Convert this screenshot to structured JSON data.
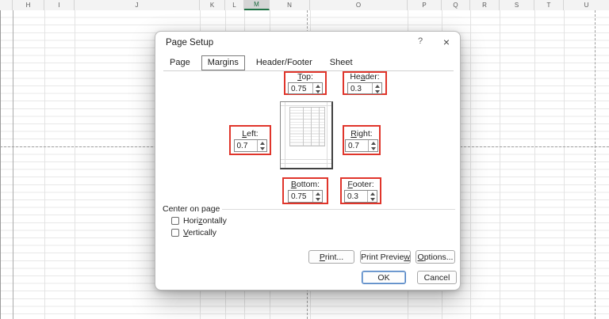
{
  "spreadsheet": {
    "columns": [
      {
        "letter": ""
      },
      {
        "letter": "H"
      },
      {
        "letter": "I"
      },
      {
        "letter": "J"
      },
      {
        "letter": "K"
      },
      {
        "letter": "L"
      },
      {
        "letter": "M"
      },
      {
        "letter": "N"
      },
      {
        "letter": "O"
      },
      {
        "letter": "P"
      },
      {
        "letter": "Q"
      },
      {
        "letter": "R"
      },
      {
        "letter": "S"
      },
      {
        "letter": "T"
      },
      {
        "letter": "U"
      }
    ],
    "selected_column": "M"
  },
  "dialog": {
    "title": "Page Setup",
    "help_icon": "?",
    "close_icon": "×",
    "tabs": [
      {
        "label": "Page"
      },
      {
        "label": "Margins"
      },
      {
        "label": "Header/Footer"
      },
      {
        "label": "Sheet"
      }
    ],
    "selected_tab": "Margins",
    "margins": {
      "top": {
        "label_pre": "",
        "label_key": "T",
        "label_post": "op:",
        "value": "0.75"
      },
      "header": {
        "label_pre": "He",
        "label_key": "a",
        "label_post": "der:",
        "value": "0.3"
      },
      "left": {
        "label_pre": "",
        "label_key": "L",
        "label_post": "eft:",
        "value": "0.7"
      },
      "right": {
        "label_pre": "",
        "label_key": "R",
        "label_post": "ight:",
        "value": "0.7"
      },
      "bottom": {
        "label_pre": "",
        "label_key": "B",
        "label_post": "ottom:",
        "value": "0.75"
      },
      "footer": {
        "label_pre": "",
        "label_key": "F",
        "label_post": "ooter:",
        "value": "0.3"
      }
    },
    "center_on_page": {
      "label": "Center on page",
      "horizontally": {
        "label_pre": "Hori",
        "label_key": "z",
        "label_post": "ontally",
        "checked": false
      },
      "vertically": {
        "label_pre": "",
        "label_key": "V",
        "label_post": "ertically",
        "checked": false
      }
    },
    "buttons": {
      "print": {
        "label_pre": "",
        "label_key": "P",
        "label_post": "rint..."
      },
      "print_preview": {
        "label_pre": "Print Previe",
        "label_key": "w",
        "label_post": ""
      },
      "options": {
        "label_pre": "",
        "label_key": "O",
        "label_post": "ptions..."
      },
      "ok": "OK",
      "cancel": "Cancel"
    }
  },
  "colors": {
    "highlight_box": "#e0352b",
    "selected_column_accent": "#217346",
    "default_button_border": "#4d7fc1"
  }
}
